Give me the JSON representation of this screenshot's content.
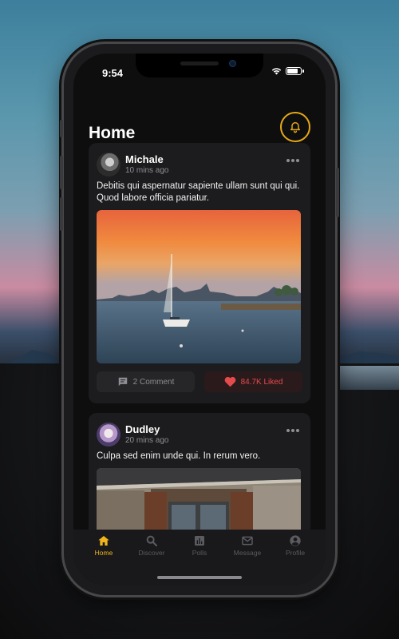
{
  "status_bar": {
    "time": "9:54"
  },
  "header": {
    "title": "Home"
  },
  "posts": [
    {
      "author": "Michale",
      "time": "10 mins ago",
      "text": "Debitis qui aspernatur sapiente ullam sunt qui qui. Quod labore officia pariatur.",
      "comments": "2 Comment",
      "likes": "84.7K Liked"
    },
    {
      "author": "Dudley",
      "time": "20 mins ago",
      "text": "Culpa sed enim unde qui. In rerum vero."
    }
  ],
  "tabs": [
    {
      "label": "Home",
      "icon": "home-icon",
      "active": true
    },
    {
      "label": "Discover",
      "icon": "search-icon",
      "active": false
    },
    {
      "label": "Polls",
      "icon": "bar-chart-icon",
      "active": false
    },
    {
      "label": "Message",
      "icon": "mail-icon",
      "active": false
    },
    {
      "label": "Profile",
      "icon": "profile-icon",
      "active": false
    }
  ],
  "colors": {
    "accent": "#F0B51C",
    "like": "#E54B4B",
    "card": "#1C1C1E",
    "background": "#0E0E0F"
  }
}
